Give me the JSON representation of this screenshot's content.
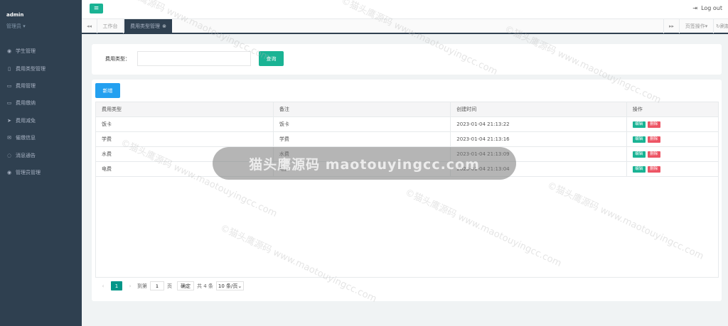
{
  "sidebar": {
    "user_name": "admin",
    "user_role": "管理员",
    "items": [
      {
        "icon": "user-circle-icon",
        "glyph": "◉",
        "label": "学生管理"
      },
      {
        "icon": "file-icon",
        "glyph": "▯",
        "label": "费用类型管理"
      },
      {
        "icon": "id-card-icon",
        "glyph": "▭",
        "label": "费用管理"
      },
      {
        "icon": "id-card-icon",
        "glyph": "▭",
        "label": "费用缴纳"
      },
      {
        "icon": "send-icon",
        "glyph": "➤",
        "label": "费用减免"
      },
      {
        "icon": "envelope-icon",
        "glyph": "✉",
        "label": "催缴信息"
      },
      {
        "icon": "comment-icon",
        "glyph": "◌",
        "label": "消息通告"
      },
      {
        "icon": "user-circle-icon",
        "glyph": "◉",
        "label": "管理员管理"
      }
    ]
  },
  "topbar": {
    "logout_label": "Log out"
  },
  "tabs": {
    "home_label": "工作台",
    "active_label": "费用类型管理",
    "ops_label": "页签操作",
    "refresh_label": "刷新"
  },
  "search": {
    "label": "费用类型：",
    "value": "",
    "button_label": "查询"
  },
  "table": {
    "add_label": "新增",
    "headers": [
      "费用类型",
      "备注",
      "创建时间",
      "操作"
    ],
    "rows": [
      {
        "type": "饭卡",
        "note": "饭卡",
        "created": "2023-01-04 21:13:22"
      },
      {
        "type": "学费",
        "note": "学费",
        "created": "2023-01-04 21:13:16"
      },
      {
        "type": "水费",
        "note": "水费",
        "created": "2023-01-04 21:13:09"
      },
      {
        "type": "电费",
        "note": "电费",
        "created": "2023-01-04 21:13:04"
      }
    ],
    "edit_label": "编辑",
    "delete_label": "删除"
  },
  "pager": {
    "current_page": "1",
    "goto_label": "到第",
    "goto_value": "1",
    "page_suffix": "页",
    "confirm_label": "确定",
    "total_label": "共 4 条",
    "size_label": "10 条/页"
  },
  "watermark": {
    "pill_text": "猫头鹰源码 maotouyingcc.com",
    "repeat_text": "©猫头鹰源码 www.maotouyingcc.com"
  },
  "colors": {
    "sidebar_bg": "#2f4050",
    "primary_green": "#1ab394",
    "add_blue": "#23a0f0",
    "delete_red": "#ed5565",
    "page_teal": "#009688"
  }
}
